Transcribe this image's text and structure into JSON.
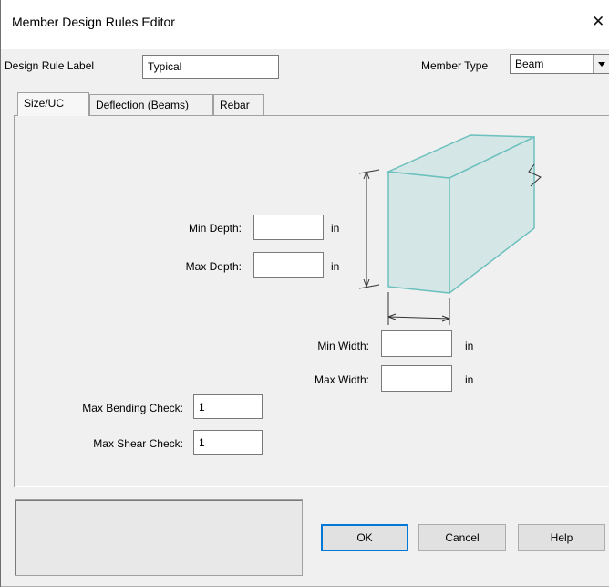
{
  "window": {
    "title": "Member Design Rules Editor",
    "close_glyph": "✕"
  },
  "header": {
    "design_rule_label": "Design Rule Label",
    "design_rule_value": "Typical",
    "member_type_label": "Member Type",
    "member_type_value": "Beam"
  },
  "tabs": [
    {
      "label": "Size/UC",
      "active": true
    },
    {
      "label": "Deflection (Beams)",
      "active": false
    },
    {
      "label": "Rebar",
      "active": false
    }
  ],
  "size_uc": {
    "min_depth_label": "Min Depth:",
    "min_depth_value": "",
    "max_depth_label": "Max Depth:",
    "max_depth_value": "",
    "min_width_label": "Min Width:",
    "min_width_value": "",
    "max_width_label": "Max Width:",
    "max_width_value": "",
    "unit": "in",
    "max_bending_label": "Max Bending Check:",
    "max_bending_value": "1",
    "max_shear_label": "Max Shear Check:",
    "max_shear_value": "1"
  },
  "buttons": {
    "ok": "OK",
    "cancel": "Cancel",
    "help": "Help"
  },
  "colors": {
    "beam_fill": "#d4e6e6",
    "beam_stroke": "#6cc0bd"
  }
}
